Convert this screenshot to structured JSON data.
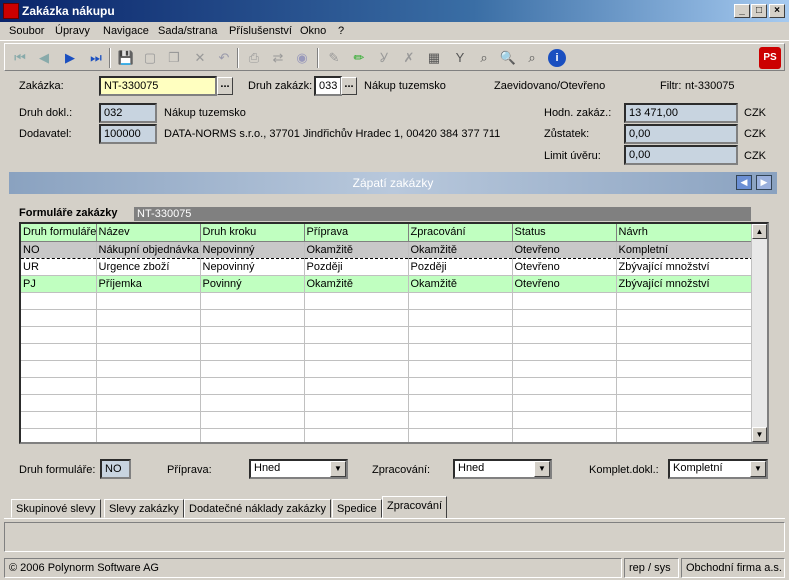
{
  "window": {
    "title": "Zakázka nákupu",
    "minimize": "_",
    "maximize": "□",
    "close": "×"
  },
  "menu": [
    "Soubor",
    "Úpravy",
    "Navigace",
    "Sada/strana",
    "Příslušenství",
    "Okno",
    "?"
  ],
  "header": {
    "zakazka_label": "Zakázka:",
    "zakazka_value": "NT-330075",
    "druh_zakazk_label": "Druh zakázk:",
    "druh_zakazk_value": "033",
    "druh_zakazk_text": "Nákup tuzemsko",
    "status_text": "Zaevidovano/Otevřeno",
    "filtr_label": "Filtr:",
    "filtr_value": "nt-330075",
    "druh_dokl_label": "Druh dokl.:",
    "druh_dokl_value": "032",
    "druh_dokl_text": "Nákup tuzemsko",
    "dodavatel_label": "Dodavatel:",
    "dodavatel_value": "100000",
    "dodavatel_text": "DATA-NORMS s.r.o., 37701 Jindřichův Hradec 1, 00420 384 377 711",
    "hodn_label": "Hodn. zakáz.:",
    "hodn_value": "13 471,00",
    "zustatek_label": "Zůstatek:",
    "zustatek_value": "0,00",
    "limit_label": "Limit úvěru:",
    "limit_value": "0,00",
    "currency": "CZK"
  },
  "panel": {
    "title": "Zápatí zakázky",
    "section_label": "Formuláře zakázky",
    "section_value": "NT-330075"
  },
  "grid": {
    "columns": [
      "Druh formuláře",
      "Název",
      "Druh kroku",
      "Příprava",
      "Zpracování",
      "Status",
      "Návrh"
    ],
    "rows": [
      [
        "NO",
        "Nákupní objednávka",
        "Nepovinný",
        "Okamžitě",
        "Okamžitě",
        "Otevřeno",
        "Kompletní"
      ],
      [
        "UR",
        "Urgence zboží",
        "Nepovinný",
        "Později",
        "Později",
        "Otevřeno",
        "Zbývající množství"
      ],
      [
        "PJ",
        "Příjemka",
        "Povinný",
        "Okamžitě",
        "Okamžitě",
        "Otevřeno",
        "Zbývající množství"
      ]
    ]
  },
  "footer_fields": {
    "druh_form_label": "Druh formuláře:",
    "druh_form_value": "NO",
    "priprava_label": "Příprava:",
    "priprava_value": "Hned",
    "zpracovani_label": "Zpracování:",
    "zpracovani_value": "Hned",
    "komplet_label": "Komplet.dokl.:",
    "komplet_value": "Kompletní"
  },
  "tabs": [
    "Skupinové slevy",
    "Slevy zakázky",
    "Dodatečné náklady zakázky",
    "Spedice",
    "Zpracování"
  ],
  "status": {
    "copyright": "© 2006 Polynorm Software AG",
    "user": "rep / sys",
    "company": "Obchodní firma a.s."
  }
}
